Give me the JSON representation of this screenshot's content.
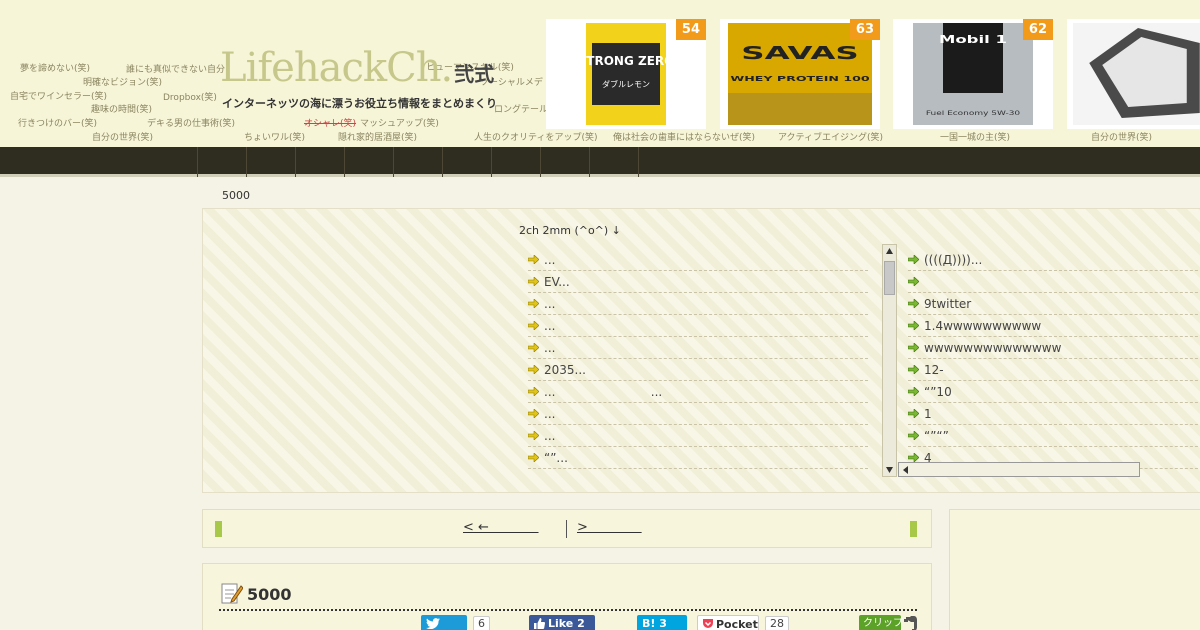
{
  "header": {
    "logo_main": "LifehackCh.",
    "logo_suffix": "弐式",
    "tagline": "インターネッツの海に漂うお役立ち情報をまとめまくり",
    "tags": [
      "夢を諦めない(笑)",
      "誰にも真似できない自分",
      "ヒューマンスキル(笑)",
      "明確なビジョン(笑)",
      "ソーシャルメデ",
      "自宅でワインセラー(笑)",
      "Dropbox(笑)",
      "趣味の時間(笑)",
      "ロングテール",
      "デキる男の仕事術(笑)",
      "マッシュアップ(笑)",
      "行きつけのバー(笑)",
      "自分の世界(笑)",
      "ちょいワル(笑)",
      "隠れ家的居酒屋(笑)",
      "人生のクオリティをアップ(笑)",
      "俺は社会の歯車にはならないぜ(笑)",
      "アクティブエイジング(笑)",
      "一国一城の主(笑)",
      "自分の世界(笑)",
      "オシャレ(笑)"
    ]
  },
  "products": [
    {
      "rank": "54",
      "name": "STRONG ZERO",
      "sub": "ダブルレモン",
      "color": "#1a1a1a"
    },
    {
      "rank": "63",
      "name": "SAVAS",
      "sub": "WHEY PROTEIN 100",
      "color": "#d4a800"
    },
    {
      "rank": "62",
      "name": "Mobil 1",
      "sub": "Fuel Economy 5W-30",
      "color": "#9aa0a6"
    },
    {
      "rank": "",
      "name": "",
      "sub": "",
      "color": "#444"
    }
  ],
  "breadcrumb": "5000",
  "feed": {
    "title": "2ch  2mm (^o^) ↓",
    "left": [
      "...",
      "EV...",
      "...",
      "...",
      "...",
      "2035...",
      "...                         ...",
      "...",
      "...",
      "“”..."
    ],
    "right": [
      "((((Д))))...",
      "",
      "9twitter",
      "1.4wwwwwwwwww",
      "wwwwwwwwwwwwww",
      "12-",
      "“”10",
      "1",
      "“”“”",
      "4"
    ]
  },
  "pager": {
    "prev": "< ←            ",
    "next": ">             "
  },
  "article": {
    "title": "5000",
    "twitter_count": "6",
    "fb_label": "Like 2",
    "hatena_label": "B! 3",
    "pocket_label": "Pocket",
    "pocket_count": "28",
    "clip_label": "クリップ"
  }
}
